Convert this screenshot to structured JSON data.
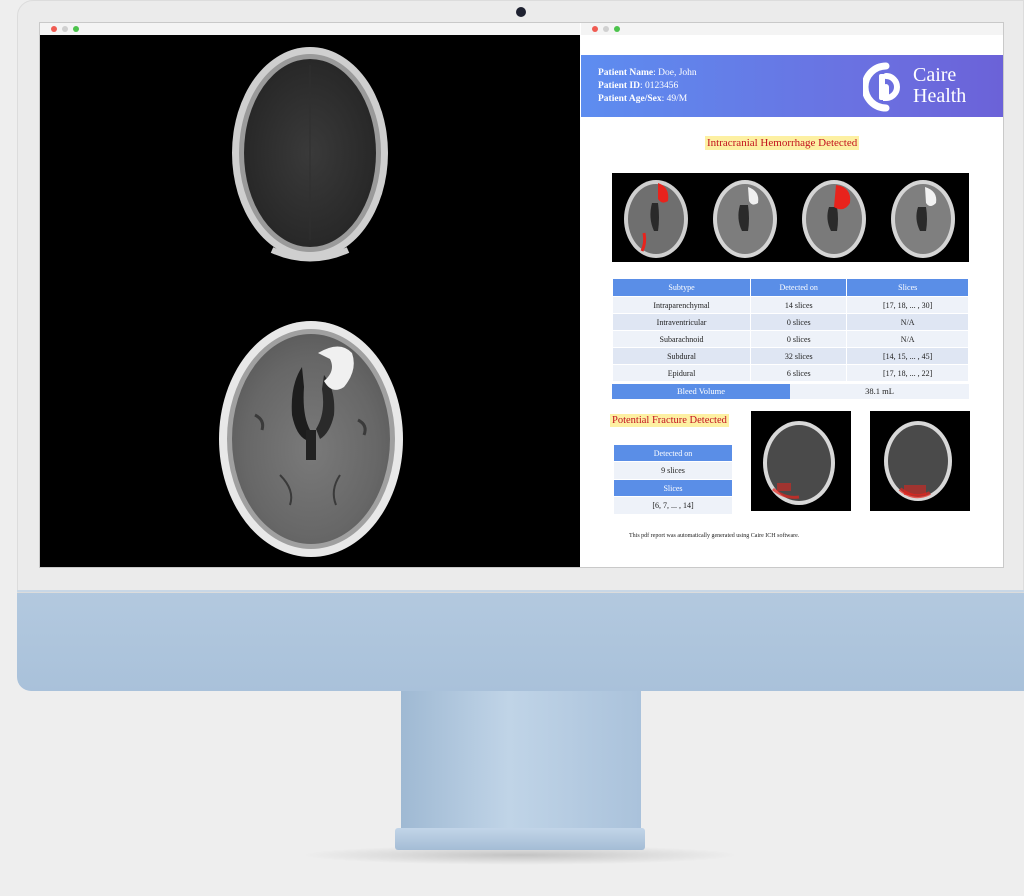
{
  "report": {
    "patient_name_label": "Patient Name",
    "patient_name": ": Doe, John",
    "patient_id_label": "Patient ID",
    "patient_id": ": 0123456",
    "patient_age_label": "Patient Age/Sex",
    "patient_age": ": 49/M",
    "logo_text_line1": "Caire",
    "logo_text_line2": "Health",
    "hemorrhage_title": "Intracranial Hemorrhage Detected",
    "subtype_table": {
      "headers": [
        "Subtype",
        "Detected on",
        "Slices"
      ],
      "rows": [
        [
          "Intraparenchymal",
          "14 slices",
          "[17, 18, ... , 30]"
        ],
        [
          "Intraventricular",
          "0 slices",
          "N/A"
        ],
        [
          "Subarachnoid",
          "0 slices",
          "N/A"
        ],
        [
          "Subdural",
          "32 slices",
          "[14, 15, ... , 45]"
        ],
        [
          "Epidural",
          "6 slices",
          "[17, 18, ... , 22]"
        ]
      ]
    },
    "bleed_volume_label": "Bleed Volume",
    "bleed_volume_value": "38.1 mL",
    "fracture_title": "Potential Fracture Detected",
    "fracture_table": {
      "detected_on_label": "Detected on",
      "detected_on_value": "9 slices",
      "slices_label": "Slices",
      "slices_value": "[6, 7, ... , 14]"
    },
    "footer": "This pdf report was automatically generated using Caire ICH software."
  },
  "colors": {
    "header_gradient_start": "#5d8df0",
    "header_gradient_end": "#6b62d8",
    "table_header": "#5a8ee7",
    "highlight": "#fdf0a2",
    "alert_text": "#c2121e",
    "hemorrhage_overlay": "#e8231c"
  },
  "icons": [
    "caire-health-logo-icon",
    "window-close-icon",
    "window-minimize-icon",
    "window-zoom-icon"
  ]
}
